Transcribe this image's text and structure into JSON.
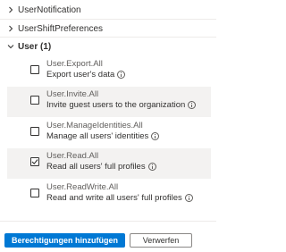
{
  "groups": [
    {
      "label": "UserNotification",
      "expanded": false
    },
    {
      "label": "UserShiftPreferences",
      "expanded": false
    },
    {
      "label": "User (1)",
      "expanded": true
    }
  ],
  "permissions": [
    {
      "name": "User.Export.All",
      "description": "Export user's data",
      "checked": false
    },
    {
      "name": "User.Invite.All",
      "description": "Invite guest users to the organization",
      "checked": false
    },
    {
      "name": "User.ManageIdentities.All",
      "description": "Manage all users' identities",
      "checked": false
    },
    {
      "name": "User.Read.All",
      "description": "Read all users' full profiles",
      "checked": true
    },
    {
      "name": "User.ReadWrite.All",
      "description": "Read and write all users' full profiles",
      "checked": false
    }
  ],
  "buttons": {
    "primary": "Berechtigungen hinzufügen",
    "secondary": "Verwerfen"
  },
  "colors": {
    "accent": "#0078d4",
    "row_shade": "#f3f2f1",
    "text": "#323130"
  }
}
